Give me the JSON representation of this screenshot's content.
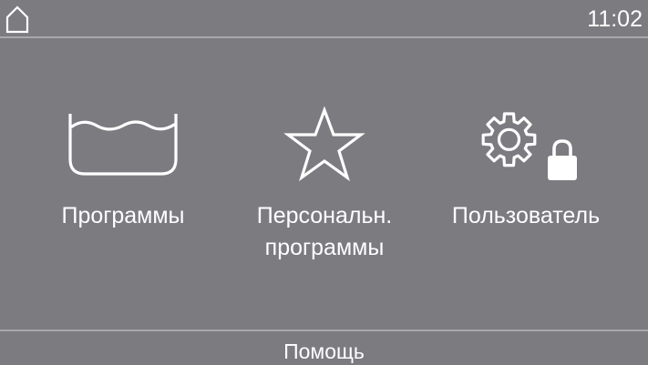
{
  "status_bar": {
    "home_icon": "home-icon",
    "time": "11:02"
  },
  "menu": {
    "items": [
      {
        "label": "Программы",
        "icon": "basin-icon"
      },
      {
        "label_line1": "Персональн.",
        "label_line2": "программы",
        "icon": "star-icon"
      },
      {
        "label": "Пользователь",
        "icon": "gear-lock-icon"
      }
    ]
  },
  "footer": {
    "help_label": "Помощь"
  },
  "colors": {
    "background": "#7c7b80",
    "divider": "#a9a8ad",
    "foreground": "#ffffff"
  }
}
